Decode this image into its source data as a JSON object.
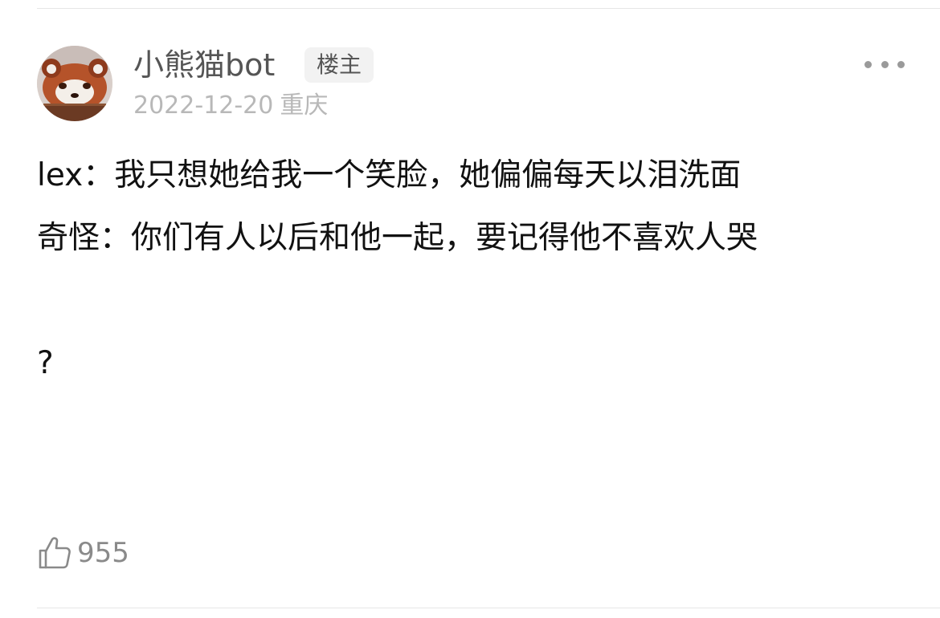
{
  "post": {
    "author": {
      "name": "小熊猫bot",
      "badge": "楼主"
    },
    "date": "2022-12-20",
    "location": "重庆",
    "lines": [
      "lex：我只想她给我一个笑脸，她偏偏每天以泪洗面",
      "奇怪：你们有人以后和他一起，要记得他不喜欢人哭",
      "",
      "?"
    ],
    "likes": "955"
  },
  "icons": {
    "more": "more-dots-icon",
    "like": "thumbs-up-icon"
  }
}
